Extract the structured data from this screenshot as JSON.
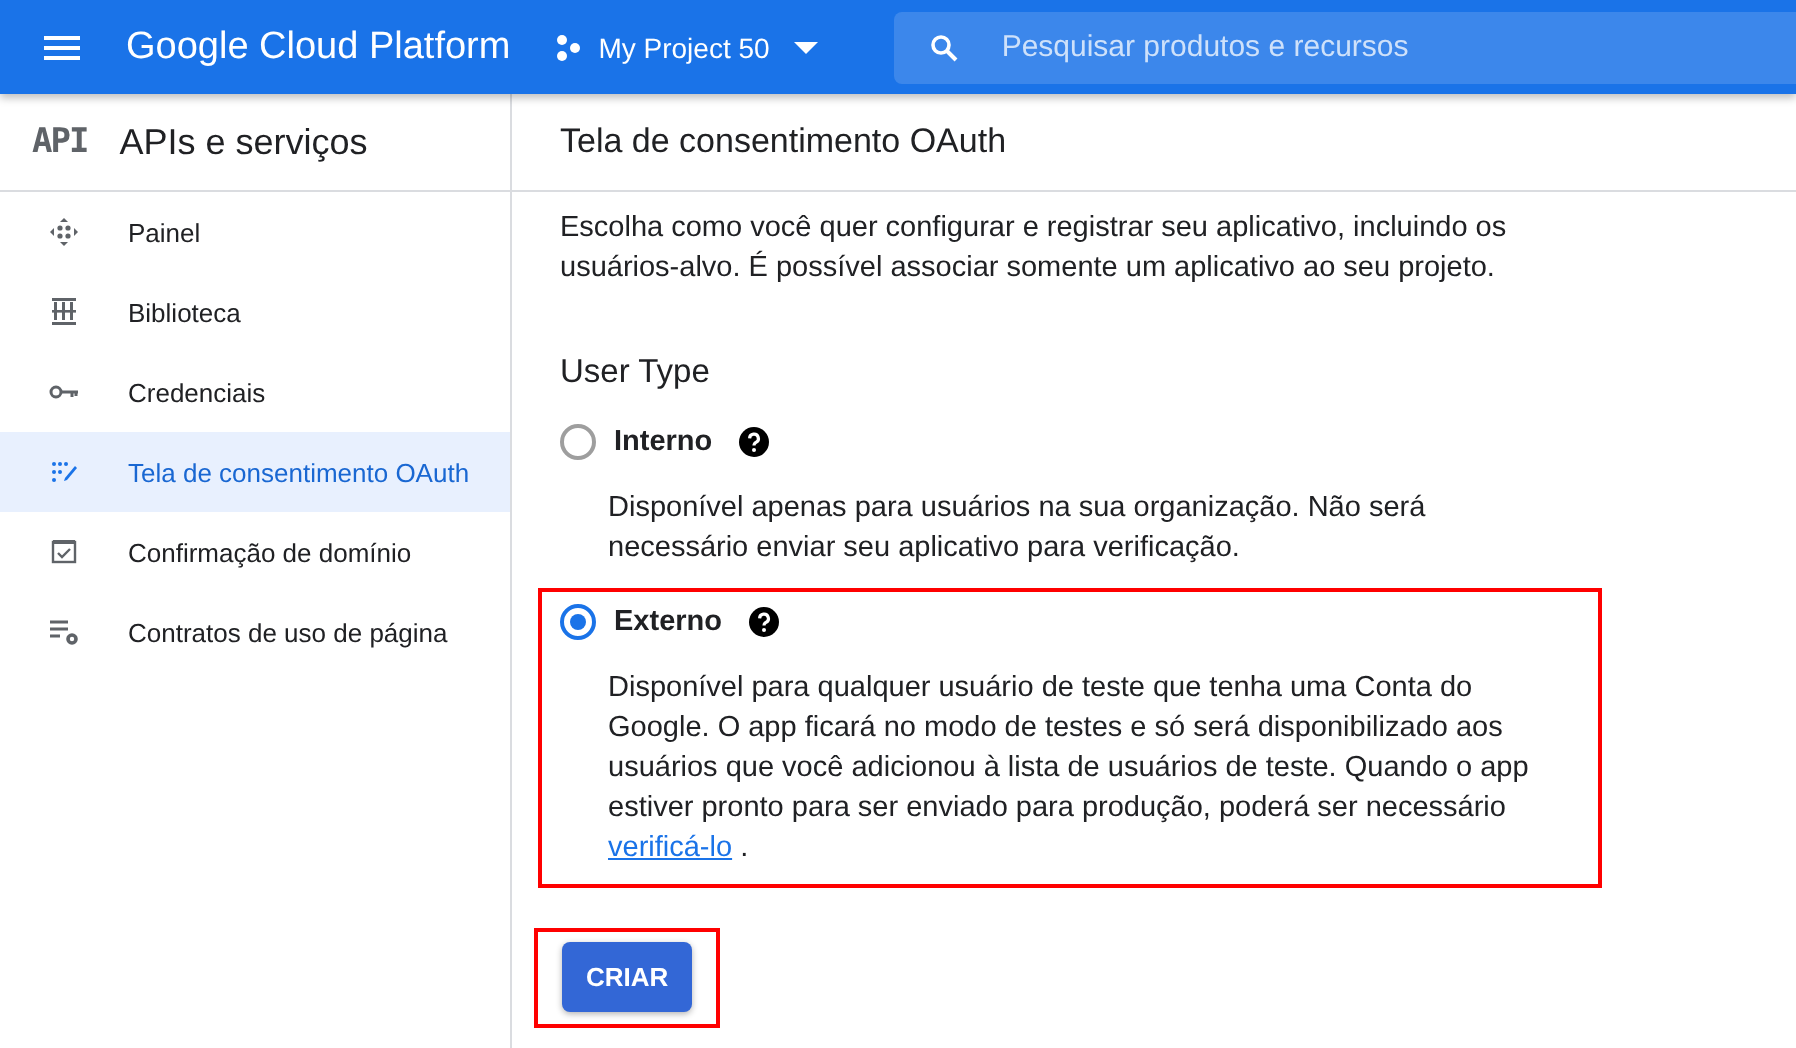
{
  "topbar": {
    "product": "Google Cloud Platform",
    "project": "My Project 50",
    "search": {
      "placeholder": "Pesquisar produtos e recursos"
    }
  },
  "sidebar": {
    "logo": "API",
    "title": "APIs e serviços",
    "items": [
      {
        "label": "Painel",
        "selected": false
      },
      {
        "label": "Biblioteca",
        "selected": false
      },
      {
        "label": "Credenciais",
        "selected": false
      },
      {
        "label": "Tela de consentimento OAuth",
        "selected": true
      },
      {
        "label": "Confirmação de domínio",
        "selected": false
      },
      {
        "label": "Contratos de uso de página",
        "selected": false
      }
    ]
  },
  "page": {
    "title": "Tela de consentimento OAuth",
    "intro": "Escolha como você quer configurar e registrar seu aplicativo, incluindo os usuários-alvo. É possível associar somente um aplicativo ao seu projeto.",
    "section_title": "User Type",
    "options": [
      {
        "label": "Interno",
        "selected": false,
        "highlighted": false,
        "description": "Disponível apenas para usuários na sua organização. Não será necessário enviar seu aplicativo para verificação."
      },
      {
        "label": "Externo",
        "selected": true,
        "highlighted": true,
        "description": "Disponível para qualquer usuário de teste que tenha uma Conta do Google. O app ficará no modo de testes e só será disponibilizado aos usuários que você adicionou à lista de usuários de teste. Quando o app estiver pronto para ser enviado para produção, poderá ser necessário",
        "link": "verificá-lo",
        "suffix": " ."
      }
    ],
    "button": {
      "label": "CRIAR",
      "highlighted": true
    }
  }
}
